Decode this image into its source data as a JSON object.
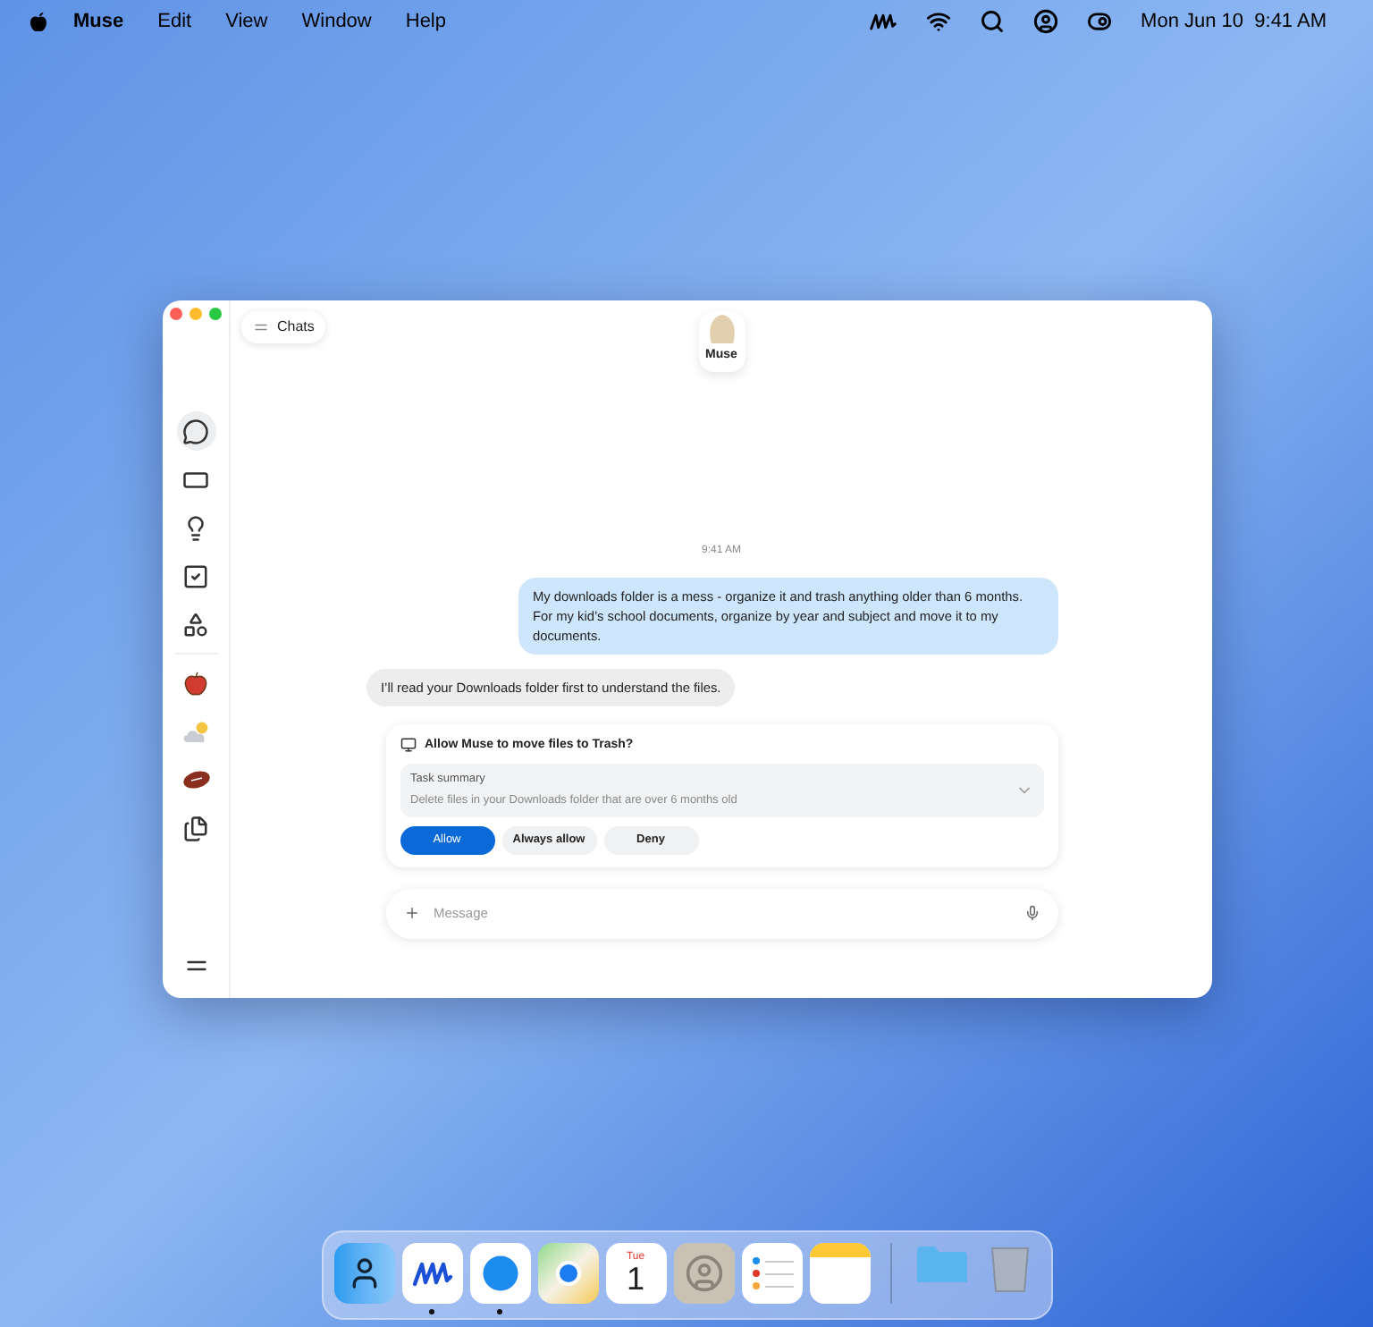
{
  "menu_bar": {
    "menus": [
      "Muse",
      "Edit",
      "View",
      "Window",
      "Help"
    ],
    "status_icons": [
      {
        "kind": "muse"
      },
      {
        "kind": "wifi"
      },
      {
        "kind": "search"
      },
      {
        "kind": "user"
      },
      {
        "kind": "control"
      }
    ],
    "clock": "Mon Jun 10  9:41 AM"
  },
  "window": {
    "chats_button": "Chats",
    "assistant": {
      "name": "Muse"
    },
    "sidebar": {
      "items": [
        {
          "kind": "chat",
          "selected": true
        },
        {
          "kind": "screen",
          "selected": false
        },
        {
          "kind": "bulb",
          "selected": false
        },
        {
          "kind": "check",
          "selected": false
        },
        {
          "kind": "shapes",
          "selected": false
        },
        {
          "kind": "apple",
          "selected": false
        },
        {
          "kind": "weather",
          "selected": false
        },
        {
          "kind": "football",
          "selected": false
        },
        {
          "kind": "files",
          "selected": false
        }
      ]
    },
    "timestamp": "9:41 AM",
    "messages": [
      {
        "kind": "user",
        "text": "My downloads folder is a mess - organize it and trash anything older than 6 months. For my kid’s school documents, organize by year and subject and move it to my documents."
      },
      {
        "kind": "assistant",
        "text": "I’ll read your Downloads folder first to understand the files."
      }
    ],
    "permission": {
      "title": "Allow Muse to move files to Trash?",
      "summary": {
        "label": "Task summary",
        "text": "Delete files in your Downloads folder that are over 6 months old",
        "expanded": false
      },
      "buttons": [
        {
          "label": "Allow",
          "kind": "primary"
        },
        {
          "label": "Always allow",
          "kind": "secondary"
        },
        {
          "label": "Deny",
          "kind": "secondary"
        }
      ]
    },
    "composer": {
      "placeholder": "Message"
    }
  },
  "dock": {
    "items": [
      {
        "kind": "finder",
        "running": false
      },
      {
        "kind": "muse",
        "running": true
      },
      {
        "kind": "safari",
        "running": true
      },
      {
        "kind": "maps",
        "running": false
      },
      {
        "kind": "calendar",
        "running": false,
        "day": "Tue",
        "date": "1"
      },
      {
        "kind": "contacts",
        "running": false
      },
      {
        "kind": "reminders",
        "running": false
      },
      {
        "kind": "notes",
        "running": false
      },
      {
        "kind": "separator"
      },
      {
        "kind": "folder",
        "running": false
      },
      {
        "kind": "trash",
        "running": false
      }
    ]
  }
}
